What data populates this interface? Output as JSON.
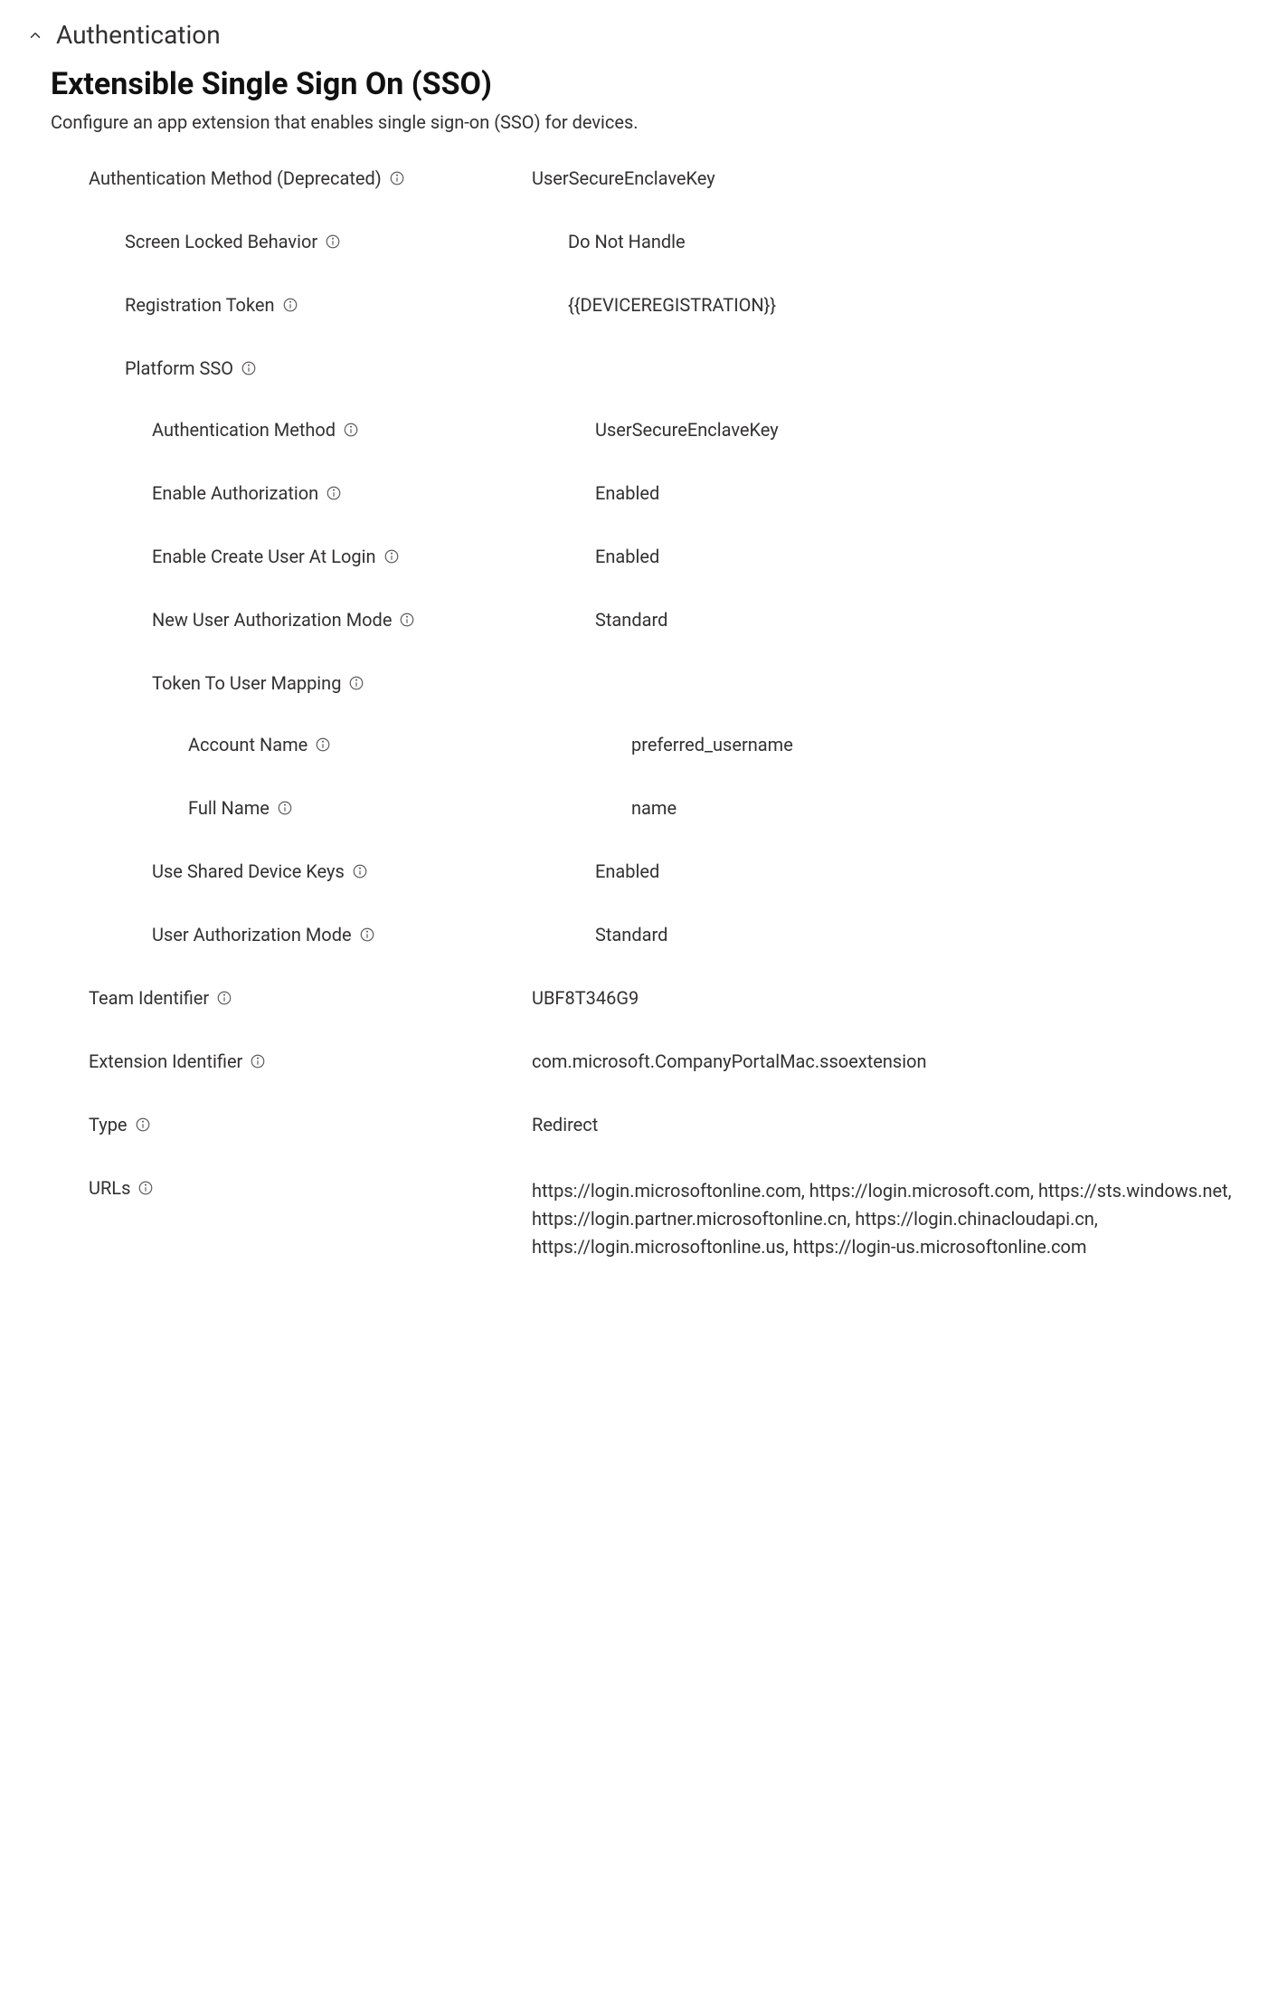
{
  "header": {
    "collapse_title": "Authentication",
    "section_title": "Extensible Single Sign On (SSO)",
    "section_desc": "Configure an app extension that enables single sign-on (SSO) for devices."
  },
  "fields": {
    "auth_method_deprecated": {
      "label": "Authentication Method (Deprecated)",
      "value": "UserSecureEnclaveKey"
    },
    "screen_locked_behavior": {
      "label": "Screen Locked Behavior",
      "value": "Do Not Handle"
    },
    "registration_token": {
      "label": "Registration Token",
      "value": "{{DEVICEREGISTRATION}}"
    },
    "platform_sso": {
      "label": "Platform SSO"
    },
    "auth_method": {
      "label": "Authentication Method",
      "value": "UserSecureEnclaveKey"
    },
    "enable_authorization": {
      "label": "Enable Authorization",
      "value": "Enabled"
    },
    "enable_create_user": {
      "label": "Enable Create User At Login",
      "value": "Enabled"
    },
    "new_user_auth_mode": {
      "label": "New User Authorization Mode",
      "value": "Standard"
    },
    "token_to_user_mapping": {
      "label": "Token To User Mapping"
    },
    "account_name": {
      "label": "Account Name",
      "value": "preferred_username"
    },
    "full_name": {
      "label": "Full Name",
      "value": "name"
    },
    "use_shared_device_keys": {
      "label": "Use Shared Device Keys",
      "value": "Enabled"
    },
    "user_authorization_mode": {
      "label": "User Authorization Mode",
      "value": "Standard"
    },
    "team_identifier": {
      "label": "Team Identifier",
      "value": "UBF8T346G9"
    },
    "extension_identifier": {
      "label": "Extension Identifier",
      "value": "com.microsoft.CompanyPortalMac.ssoextension"
    },
    "type": {
      "label": "Type",
      "value": "Redirect"
    },
    "urls": {
      "label": "URLs",
      "value": "https://login.microsoftonline.com, https://login.microsoft.com, https://sts.windows.net, https://login.partner.microsoftonline.cn, https://login.chinacloudapi.cn, https://login.microsoftonline.us, https://login-us.microsoftonline.com"
    }
  }
}
